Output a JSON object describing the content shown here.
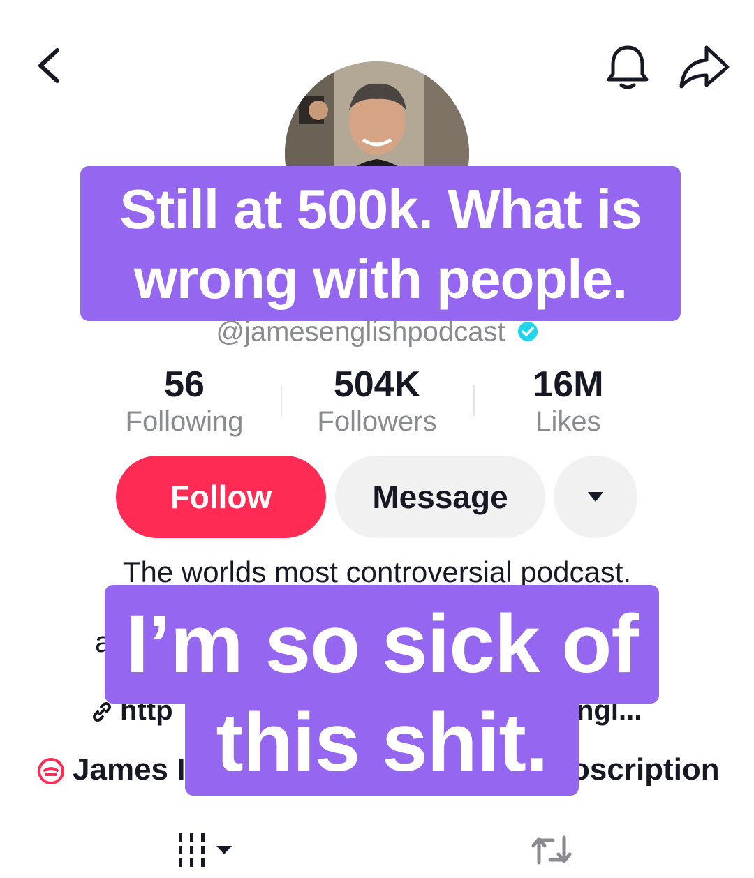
{
  "header": {
    "back_icon": "chevron-left-icon",
    "notification_icon": "bell-icon",
    "share_icon": "share-arrow-icon"
  },
  "profile": {
    "handle": "@jamesenglishpodcast",
    "verified": true,
    "accent_verified": "#20d5ec"
  },
  "stats": [
    {
      "value": "56",
      "label": "Following"
    },
    {
      "value": "504K",
      "label": "Followers"
    },
    {
      "value": "16M",
      "label": "Likes"
    }
  ],
  "actions": {
    "follow_label": "Follow",
    "message_label": "Message",
    "follow_color": "#fe2c55",
    "secondary_color": "#f1f1f2"
  },
  "bio": {
    "line1": "The worlds most controversial podcast.",
    "line2_visible": "a",
    "link_visible_start": "http",
    "link_visible_end": "ngl...",
    "subscription_visible_start": "James I",
    "subscription_visible_end": "oscription"
  },
  "overlays": {
    "caption_top": "Still at 500k. What is wrong with people.",
    "caption_top_line1": "Still at 500k. What is",
    "caption_top_line2": "wrong with people.",
    "caption_bottom_line1": "I’m so sick of",
    "caption_bottom_line2": "this shit.",
    "caption_color": "#9566f0"
  },
  "tabs": {
    "videos_icon": "grid-icon",
    "reposts_icon": "repost-icon"
  }
}
